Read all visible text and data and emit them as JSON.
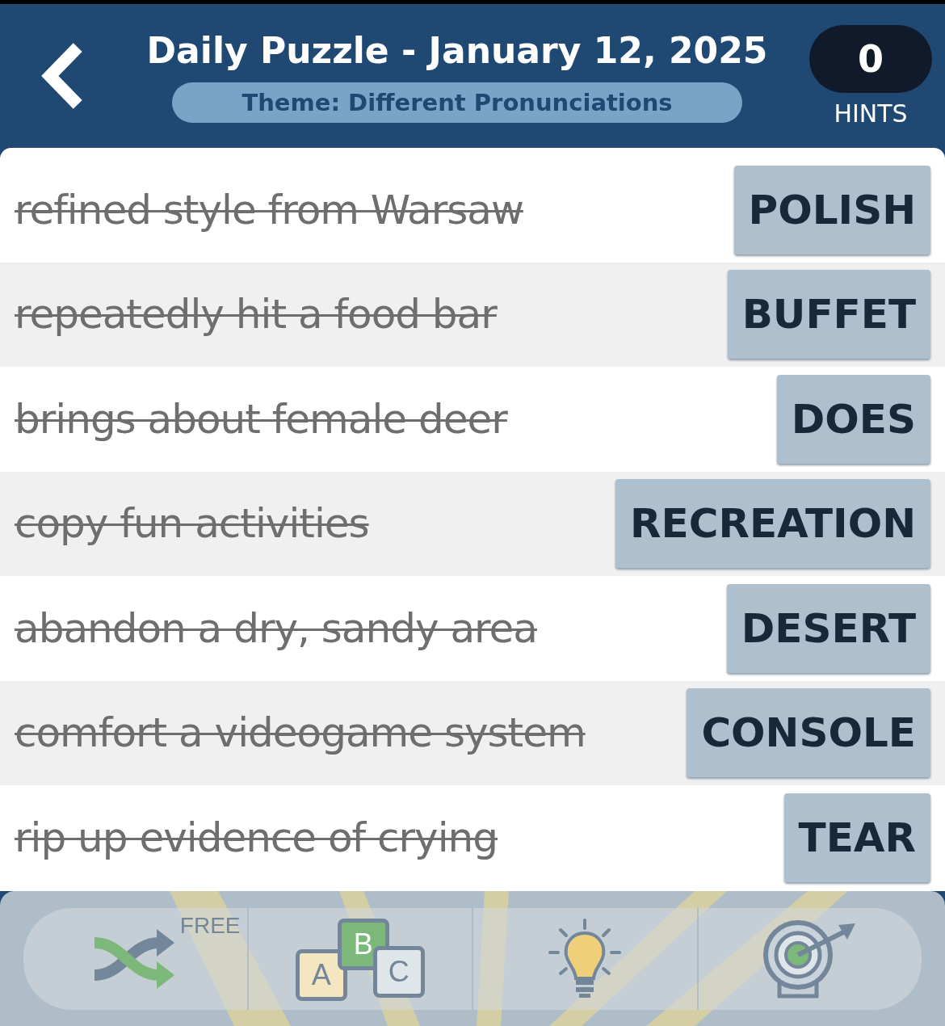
{
  "header": {
    "title": "Daily Puzzle - January 12, 2025",
    "theme": "Theme: Different Pronunciations",
    "hints": {
      "count": "0",
      "label": "HINTS"
    }
  },
  "clues": [
    {
      "clue": "refined style from Warsaw",
      "answer": "POLISH",
      "solved": true
    },
    {
      "clue": "repeatedly hit a food bar",
      "answer": "BUFFET",
      "solved": true
    },
    {
      "clue": "brings about female deer",
      "answer": "DOES",
      "solved": true
    },
    {
      "clue": "copy fun activities",
      "answer": "RECREATION",
      "solved": true
    },
    {
      "clue": "abandon a dry, sandy area",
      "answer": "DESERT",
      "solved": true
    },
    {
      "clue": "comfort a videogame system",
      "answer": "CONSOLE",
      "solved": true
    },
    {
      "clue": "rip up evidence of crying",
      "answer": "TEAR",
      "solved": true
    }
  ],
  "toolbar": [
    {
      "kind": "shuffle",
      "badge": "FREE"
    },
    {
      "kind": "letters",
      "letters": [
        "A",
        "B",
        "C"
      ]
    },
    {
      "kind": "hint"
    },
    {
      "kind": "target"
    }
  ]
}
